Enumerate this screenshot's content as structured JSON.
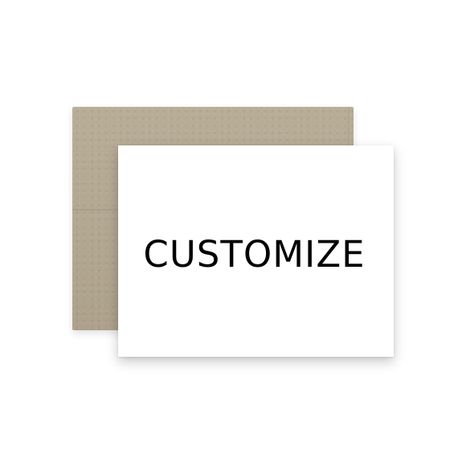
{
  "card": {
    "text": "CUSTOMIZE"
  },
  "colors": {
    "background": "#ffffff",
    "envelope": "#b3a892",
    "card": "#ffffff",
    "text": "#000000"
  }
}
